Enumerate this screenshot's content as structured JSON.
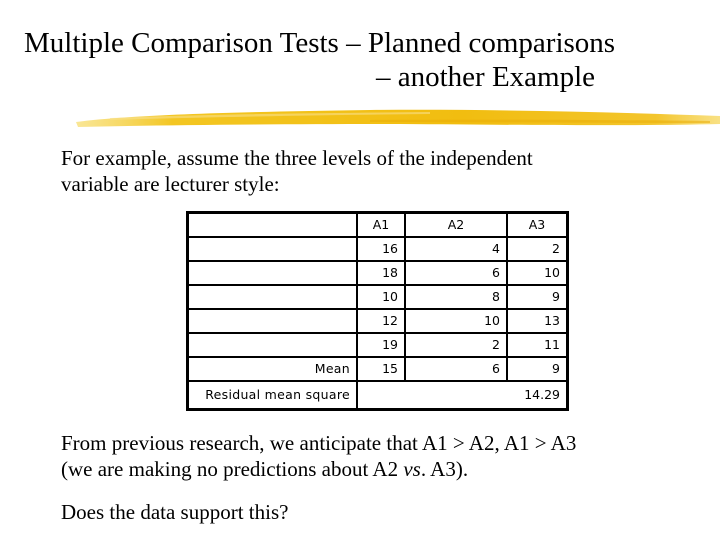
{
  "slide": {
    "title_line1": "Multiple Comparison Tests – Planned comparisons",
    "title_line2": "– another Example",
    "accent_color": "#f2c413",
    "intro_line1": "For example, assume the three levels of the independent",
    "intro_line2": "variable are lecturer style:",
    "table": {
      "headers": [
        "",
        "A1",
        "A2",
        "A3"
      ],
      "rows": [
        {
          "label": "",
          "values": [
            "16",
            "4",
            "2"
          ]
        },
        {
          "label": "",
          "values": [
            "18",
            "6",
            "10"
          ]
        },
        {
          "label": "",
          "values": [
            "10",
            "8",
            "9"
          ]
        },
        {
          "label": "",
          "values": [
            "12",
            "10",
            "13"
          ]
        },
        {
          "label": "",
          "values": [
            "19",
            "2",
            "11"
          ]
        },
        {
          "label": "Mean",
          "values": [
            "15",
            "6",
            "9"
          ]
        }
      ],
      "residual_label": "Residual mean square",
      "residual_value": "14.29"
    },
    "follow_line1": "From previous research, we anticipate that A1 > A2, A1 > A3",
    "follow_line2_pre": "(we are making no predictions about A2 ",
    "follow_line2_italic": "vs",
    "follow_line2_post": ". A3).",
    "question": "Does the data support this?"
  }
}
